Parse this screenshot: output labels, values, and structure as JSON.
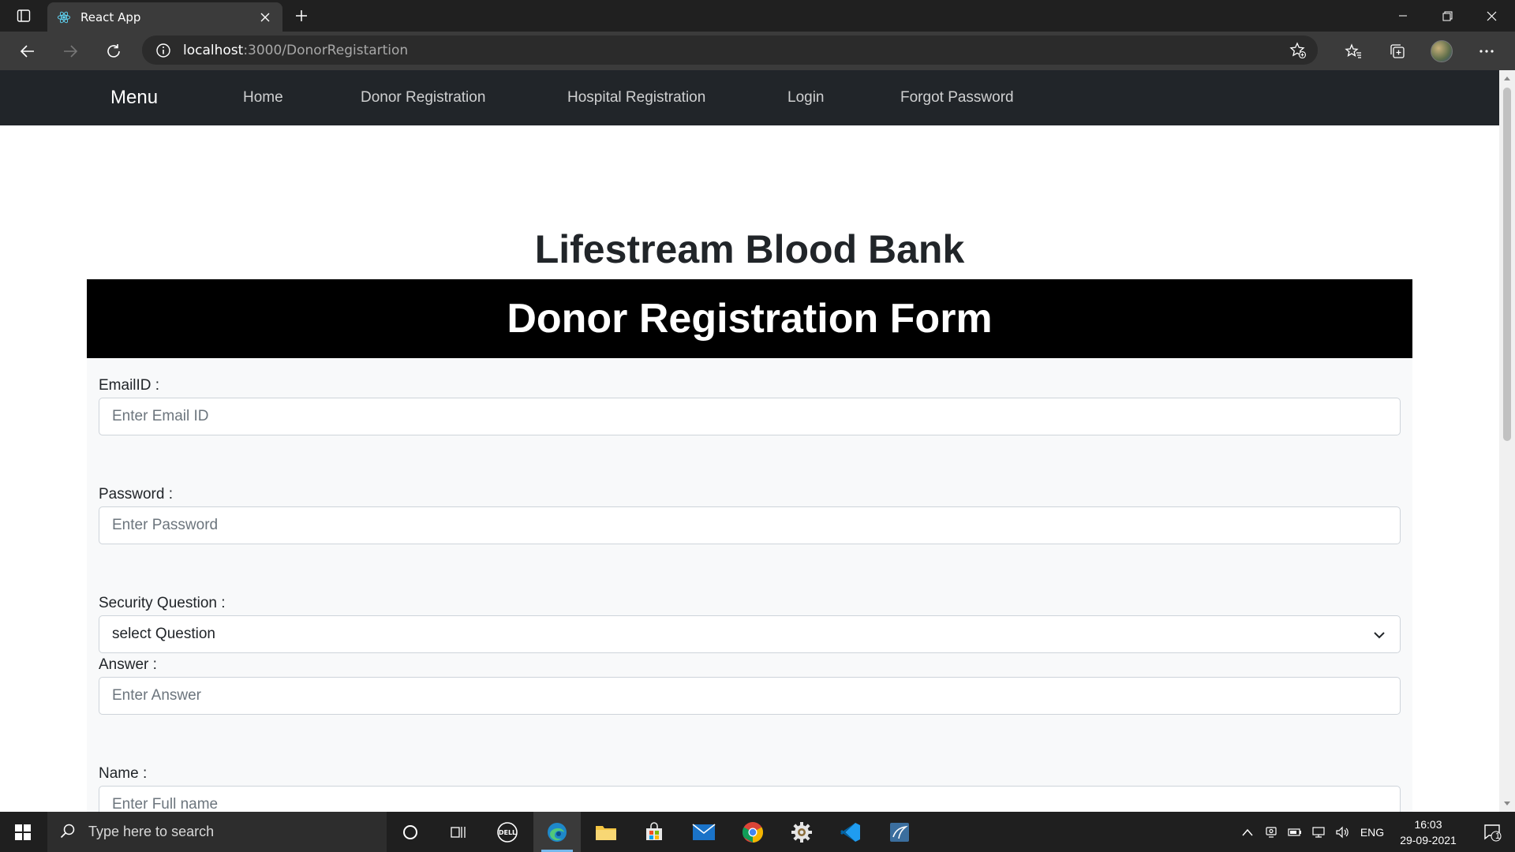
{
  "browser": {
    "tab_title": "React App",
    "url_host": "localhost",
    "url_path": ":3000/DonorRegistartion"
  },
  "sitenav": {
    "brand": "Menu",
    "links": [
      "Home",
      "Donor Registration",
      "Hospital Registration",
      "Login",
      "Forgot Password"
    ]
  },
  "page": {
    "site_title": "Lifestream Blood Bank",
    "form_title": "Donor Registration Form"
  },
  "form": {
    "email_label": "EmailID :",
    "email_placeholder": "Enter Email ID",
    "password_label": "Password :",
    "password_placeholder": "Enter Password",
    "security_label": "Security Question :",
    "security_selected": "select Question",
    "answer_label": "Answer :",
    "answer_placeholder": "Enter Answer",
    "name_label": "Name :",
    "name_placeholder": "Enter Full name"
  },
  "taskbar": {
    "search_placeholder": "Type here to search",
    "lang": "ENG",
    "time": "16:03",
    "date": "29-09-2021",
    "notification_count": "1"
  },
  "icons": {
    "tab_actions": "tab-actions-icon",
    "favicon": "react-logo-icon",
    "back": "back-arrow-icon",
    "forward": "forward-arrow-icon",
    "refresh": "refresh-icon",
    "info": "info-icon",
    "add_favorite": "star-plus-icon",
    "favorites": "favorites-icon",
    "collections": "collections-icon",
    "more": "more-dots-icon"
  },
  "colors": {
    "site_nav_bg": "#212529",
    "form_header_bg": "#000000",
    "form_bg": "#f8f9fa"
  }
}
